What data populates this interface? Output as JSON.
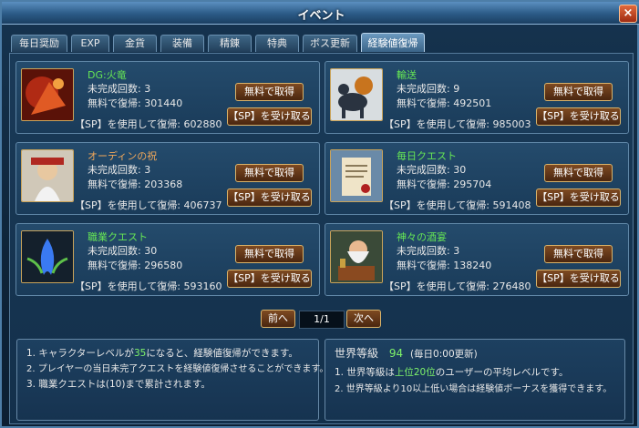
{
  "window": {
    "title": "イベント",
    "close": "×"
  },
  "tabs": [
    "毎日奨励",
    "EXP",
    "金貨",
    "装備",
    "精錬",
    "特典",
    "ボス更新",
    "経験値復帰"
  ],
  "cards": [
    {
      "name": "DG:火竜",
      "remaining": "未完成回数: 3",
      "free": "無料で復帰:  301440",
      "sp": "【SP】を使用して復帰: 602880",
      "icon": "red-dragon-icon"
    },
    {
      "name": "輸送",
      "remaining": "未完成回数: 9",
      "free": "無料で復帰:  492501",
      "sp": "【SP】を使用して復帰: 985003",
      "icon": "transport-horse-icon"
    },
    {
      "name": "オーディンの祝",
      "remaining": "未完成回数: 3",
      "free": "無料で復帰:  203368",
      "sp": "【SP】を使用して復帰: 406737",
      "icon": "odin-icon"
    },
    {
      "name": "毎日クエスト",
      "remaining": "未完成回数: 30",
      "free": "無料で復帰:  295704",
      "sp": "【SP】を使用して復帰: 591408",
      "icon": "scroll-icon"
    },
    {
      "name": "職業クエスト",
      "remaining": "未完成回数: 30",
      "free": "無料で復帰:  296580",
      "sp": "【SP】を使用して復帰: 593160",
      "icon": "blue-flame-icon"
    },
    {
      "name": "神々の酒宴",
      "remaining": "未完成回数: 3",
      "free": "無料で復帰:  138240",
      "sp": "【SP】を使用して復帰: 276480",
      "icon": "feast-icon"
    }
  ],
  "buttons": {
    "free": "無料で取得",
    "sp": "【SP】を受け取る"
  },
  "pager": {
    "prev": "前へ",
    "page": "1/1",
    "next": "次へ"
  },
  "notes": {
    "line1_pre": "1. キャラクターレベルが",
    "line1_hl": "35",
    "line1_post": "になると、経験値復帰ができます。",
    "line2": "2. プレイヤーの当日未完了クエストを経験値復帰させることができます。",
    "line3": "3. 職業クエストは(10)まで累計されます。"
  },
  "world": {
    "label": "世界等級",
    "level": "94",
    "update": "(毎日0:00更新)",
    "line1_pre": "1. 世界等級は",
    "line1_hl": "上位20位",
    "line1_post": "のユーザーの平均レベルです。",
    "line2": "2. 世界等級より10以上低い場合は経験値ボーナスを獲得できます。"
  }
}
